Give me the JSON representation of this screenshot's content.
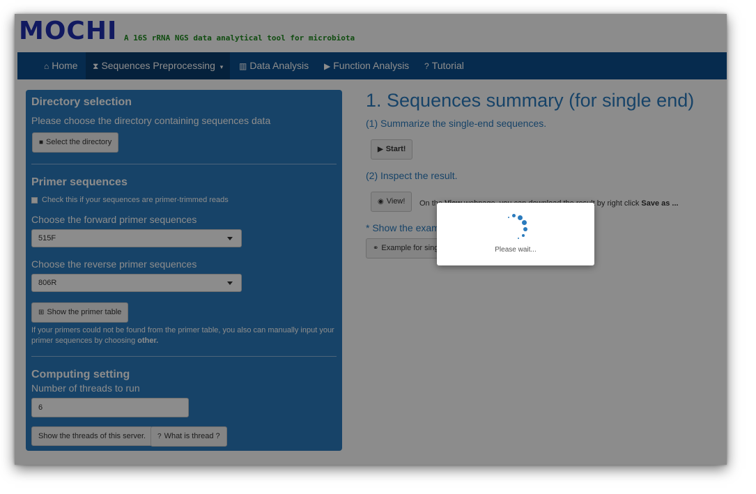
{
  "header": {
    "app_name": "MOCHI",
    "tagline": "A 16S rRNA NGS data analytical tool for microbiota"
  },
  "nav": {
    "home": "Home",
    "preprocessing": "Sequences Preprocessing",
    "data_analysis": "Data Analysis",
    "function_analysis": "Function Analysis",
    "tutorial": "Tutorial",
    "icons": [
      "home-icon",
      "hourglass-icon",
      "chart-icon",
      "play-icon",
      "question-icon"
    ]
  },
  "sidebar": {
    "directory_title": "Directory selection",
    "directory_desc": "Please choose the directory containing sequences data",
    "select_directory_label": "Select the directory",
    "primer_title": "Primer sequences",
    "primer_trimmed_label": "Check this if your sequences are primer-trimmed reads",
    "forward_label": "Choose the forward primer sequences",
    "forward_value": "515F",
    "reverse_label": "Choose the reverse primer sequences",
    "reverse_value": "806R",
    "primer_table_label": "Show the primer table",
    "primer_note_line1": "If your primers could not be found from the primer table, you also can manually input your",
    "primer_note_line2": "primer sequences by choosing ",
    "primer_note_bold": "other.",
    "computing_title": "Computing setting",
    "threads_label": "Number of threads to run",
    "threads_value": "6",
    "show_threads_label": "Show the threads of this server.",
    "what_thread_label": "What is thread ?"
  },
  "main": {
    "title": "1. Sequences summary (for single end)",
    "step1": "(1) Summarize the single-end sequences.",
    "start_label": "Start!",
    "step2": "(2) Inspect the result.",
    "view_label": "View!",
    "note_prefix": "On the ",
    "note_view": "View",
    "note_middle": " webpage, you can download the result by right click ",
    "note_save": "Save as ...",
    "example_heading": "* Show the example",
    "example_button": "Example for single end"
  },
  "modal": {
    "text": "Please wait..."
  },
  "colors": {
    "accent": "#2b7bbd",
    "navbar": "#0b4f8f",
    "logo": "#1f2fb0",
    "tagline": "#1e8a1e"
  }
}
